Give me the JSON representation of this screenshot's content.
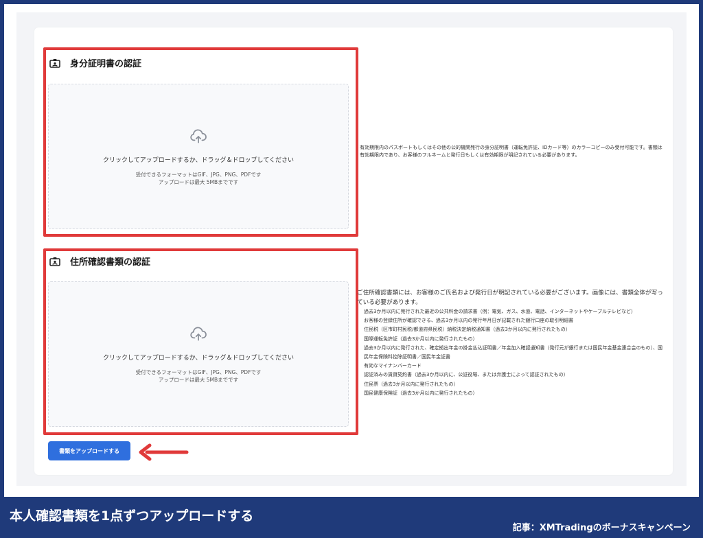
{
  "identity": {
    "title": "身分証明書の認証",
    "dropzone": {
      "main": "クリックしてアップロードするか、ドラッグ＆ドロップしてください",
      "formats": "受付できるフォーマットはGIF、JPG、PNG、PDFです",
      "max": "アップロードは最大 5MBまでです"
    },
    "description": "有効期限内のパスポートもしくはその他の公的機関発行の身分証明書（運転免許証、IDカード等）のカラーコピーのみ受付可能です。書類は有効期限内であり、お客様のフルネームと発行日もしくは有効期限が明記されている必要があります。"
  },
  "address": {
    "title": "住所確認書類の認証",
    "dropzone": {
      "main": "クリックしてアップロードするか、ドラッグ＆ドロップしてください",
      "formats": "受付できるフォーマットはGIF、JPG、PNG、PDFです",
      "max": "アップロードは最大 5MBまでです"
    },
    "description": "ご住所確認書類には、お客様のご氏名および発行日が明記されている必要がございます。画像には、書類全体が写っている必要があります。",
    "items": [
      "過去3か月以内に発行された最近の公共料金の請求書（例：電気、ガス、水道、電話、インターネットやケーブルテレビなど）",
      "お客様の登録住所が確認できる、過去3か月以内の発行年月日が記載された銀行口座の取引明細書",
      "住民税（区市町村民税/都道府県民税）納税決定納税通知書（過去3か月以内に発行されたもの）",
      "国際運転免許証（過去3か月以内に発行されたもの）",
      "過去3か月以内に発行された、確定拠出年金の掛金払込証明書／年金加入確認通知書（発行元が銀行または国民年金基金連合会のもの）、国民年金保険料控除証明書／国民年金証書",
      "有効なマイナンバーカード",
      "認証済みの賃貸契約書（過去3か月以内に、公証役場、または弁護士によって認証されたもの）",
      "住民票（過去3か月以内に発行されたもの）",
      "国民健康保険証（過去3か月以内に発行されたもの）"
    ]
  },
  "upload_button": "書類をアップロードする",
  "footer": {
    "caption": "本人確認書類を1点ずつアップロードする",
    "source": "記事：XMTradingのボーナスキャンペーン"
  },
  "colors": {
    "highlight": "#e03a3a",
    "button": "#2f6fde",
    "footer": "#1f3a7a"
  },
  "icons": [
    "id-card-icon",
    "cloud-upload-icon",
    "left-arrow-icon"
  ]
}
